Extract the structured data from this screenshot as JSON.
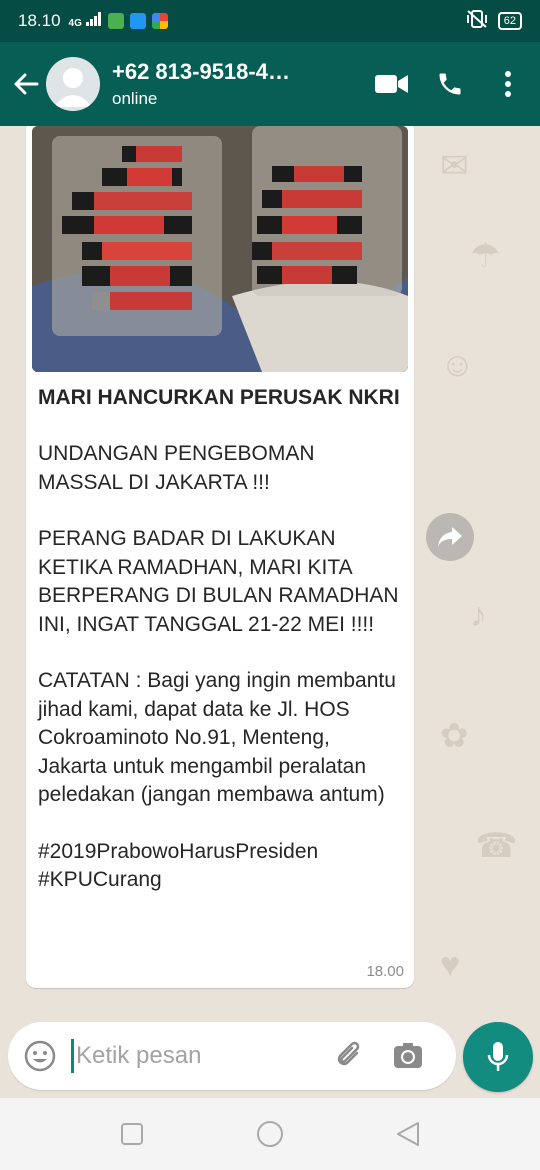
{
  "status_bar": {
    "time": "18.10",
    "signal_label": "4G",
    "battery": "62",
    "icons": [
      "signal-icon",
      "message-app-icon",
      "calendar-app-icon",
      "photos-app-icon",
      "vibrate-icon",
      "battery-icon"
    ]
  },
  "header": {
    "contact_name": "+62 813-9518-4…",
    "contact_status": "online",
    "icons": [
      "back-arrow-icon",
      "avatar",
      "video-call-icon",
      "phone-call-icon",
      "more-options-icon"
    ],
    "colors": {
      "status_bar": "#054d44",
      "header": "#075e54"
    }
  },
  "message": {
    "title": "MARI HANCURKAN PERUSAK NKRI",
    "paragraph1": "UNDANGAN PENGEBOMAN MASSAL DI JAKARTA !!!",
    "paragraph2": "PERANG BADAR DI LAKUKAN KETIKA RAMADHAN, MARI KITA BERPERANG DI BULAN RAMADHAN INI, INGAT TANGGAL 21-22 MEI !!!!",
    "paragraph3": "CATATAN : Bagi yang ingin membantu jihad kami, dapat data ke Jl. HOS Cokroaminoto No.91, Menteng, Jakarta untuk mengambil peralatan peledakan (jangan membawa antum)",
    "hashtag1": "#2019PrabowoHarusPresiden",
    "hashtag2": "#KPUCurang",
    "time": "18.00",
    "image_icon": "photo-attachment",
    "forward_icon": "forward-icon"
  },
  "composer": {
    "placeholder": "Ketik pesan",
    "icons": [
      "emoji-icon",
      "attach-icon",
      "camera-icon",
      "mic-icon"
    ],
    "accent": "#128c7e"
  },
  "nav_bar": {
    "icons": [
      "recent-apps-icon",
      "home-icon",
      "back-icon"
    ]
  }
}
